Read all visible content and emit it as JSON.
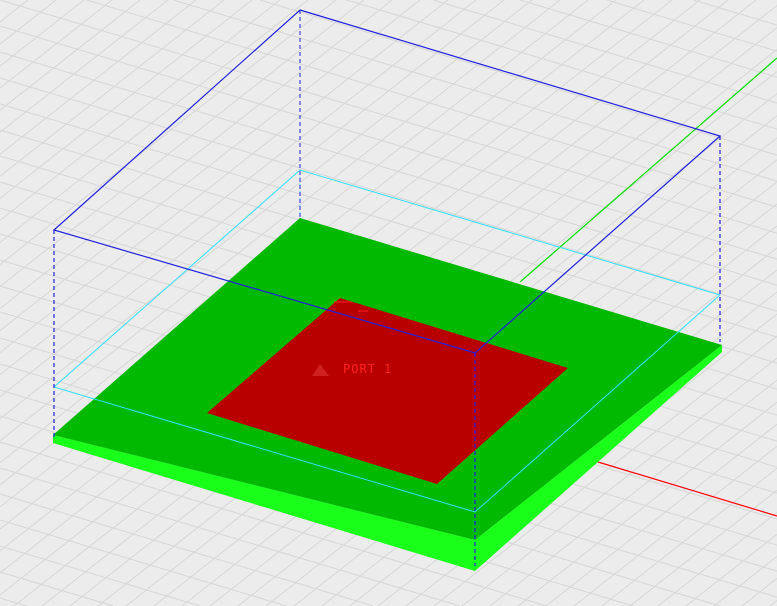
{
  "viewport": {
    "port_label": "PORT 1",
    "colors": {
      "background": "#ececec",
      "grid": "#d6d6d6",
      "substrate_top": "#00b900",
      "substrate_edge": "#19ff19",
      "patch": "#b90000",
      "airbox": "#2020e0",
      "inner_box": "#30e0ff",
      "axis_x": "#ff0000",
      "axis_y": "#00dd00"
    }
  }
}
